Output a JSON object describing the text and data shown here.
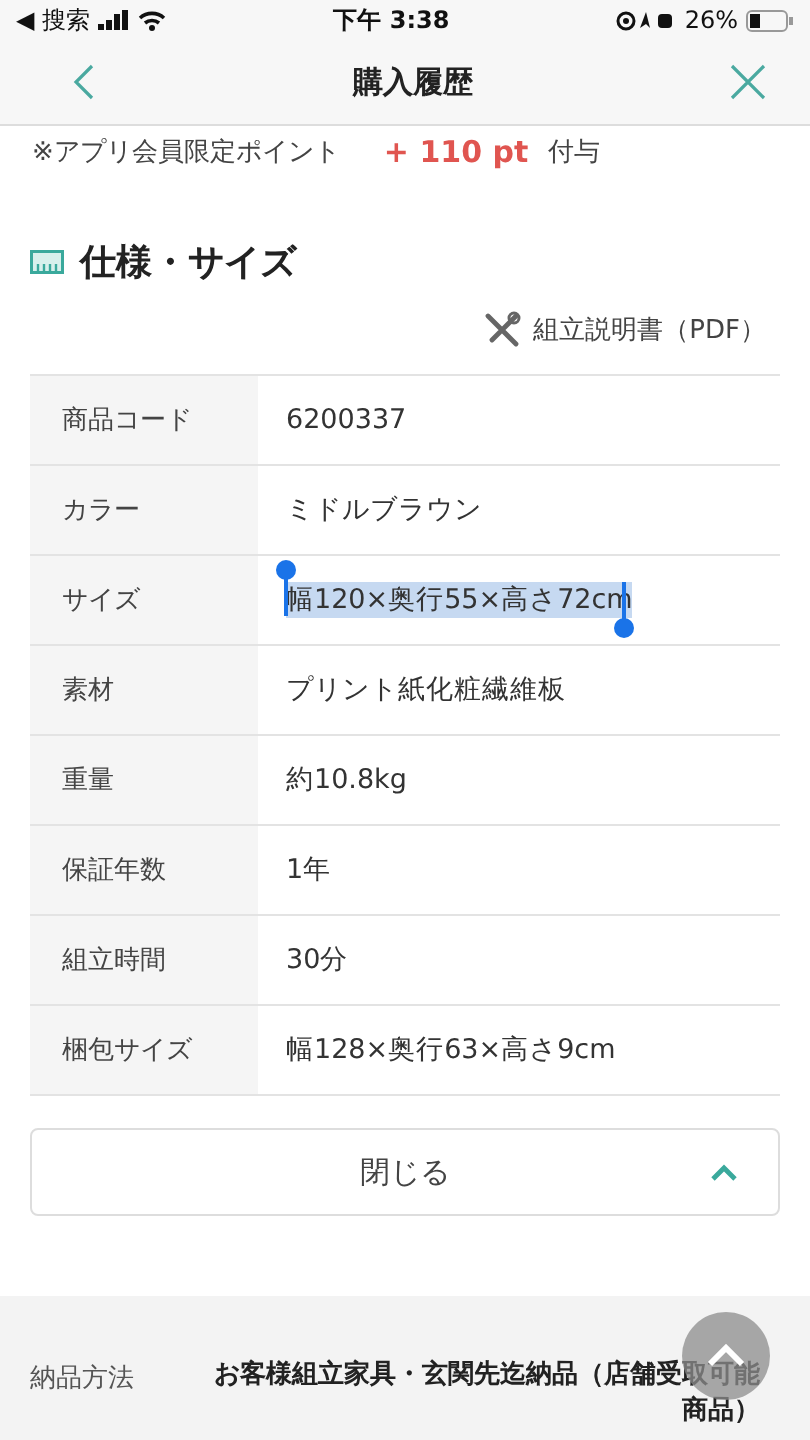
{
  "status_bar": {
    "back_label": "◀ 搜索",
    "time": "下午 3:38",
    "battery": "26%"
  },
  "nav": {
    "title": "購入履歴"
  },
  "points": {
    "label": "※アプリ会員限定ポイント",
    "value": "+ 110 pt",
    "suffix": "付与"
  },
  "section": {
    "title": "仕様・サイズ",
    "manual_link": "組立説明書（PDF）"
  },
  "specs": [
    {
      "label": "商品コード",
      "value": "6200337",
      "selected": false
    },
    {
      "label": "カラー",
      "value": "ミドルブラウン",
      "selected": false
    },
    {
      "label": "サイズ",
      "value": "幅120×奥行55×高さ72cm",
      "selected": true
    },
    {
      "label": "素材",
      "value": "プリント紙化粧繊維板",
      "selected": false
    },
    {
      "label": "重量",
      "value": "約10.8kg",
      "selected": false
    },
    {
      "label": "保証年数",
      "value": "1年",
      "selected": false
    },
    {
      "label": "組立時間",
      "value": "30分",
      "selected": false
    },
    {
      "label": "梱包サイズ",
      "value": "幅128×奥行63×高さ9cm",
      "selected": false
    }
  ],
  "close_button": {
    "label": "閉じる",
    "expanded": true
  },
  "delivery": {
    "label": "納品方法",
    "value": "お客様組立家具・玄関先迄納品（店舗受取可能商品）"
  }
}
